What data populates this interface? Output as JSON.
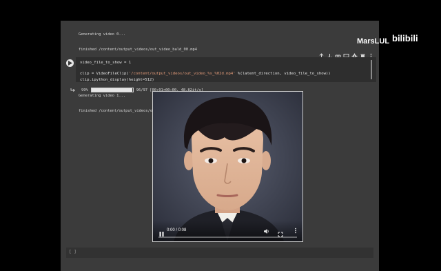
{
  "output_log": {
    "lines": [
      "Generating video 0...",
      "finished /content/output_videos/out_video_bald_00.mp4",
      "##########################",
      "",
      "Generating video 1...",
      "finished /content/output_videos/out_video_bald_01.mp4"
    ]
  },
  "cell_toolbar": {
    "icons": [
      "arrow-up-icon",
      "arrow-down-icon",
      "link-icon",
      "comment-icon",
      "gear-icon",
      "trash-icon",
      "more-vert-icon"
    ]
  },
  "code_cell": {
    "line1": "video_file_to_show = 1",
    "line2_a": "clip = VideoFileClip(",
    "line2_str": "'/content/output_videos/out_video_%s_%02d.mp4'",
    "line2_b": " %(latent_direction, video_file_to_show))",
    "line3": "clip.ipython_display(height=512)"
  },
  "progress": {
    "percent_label": "99%",
    "fraction": 0.99,
    "counts": "96/97 [00:01<00:00, 48.82it/s]"
  },
  "video": {
    "time": "0:00 / 0:08",
    "progress_fraction": 0.0
  },
  "watermark": {
    "name": "MarsLUL",
    "logo_text": "bilibili"
  },
  "bottom_strip": {
    "text": "[ ]"
  },
  "colors": {
    "page_background": "#000000",
    "notebook_background": "#3b3b3b",
    "code_background": "#2e2e2e",
    "string_color": "#e59c7a"
  }
}
